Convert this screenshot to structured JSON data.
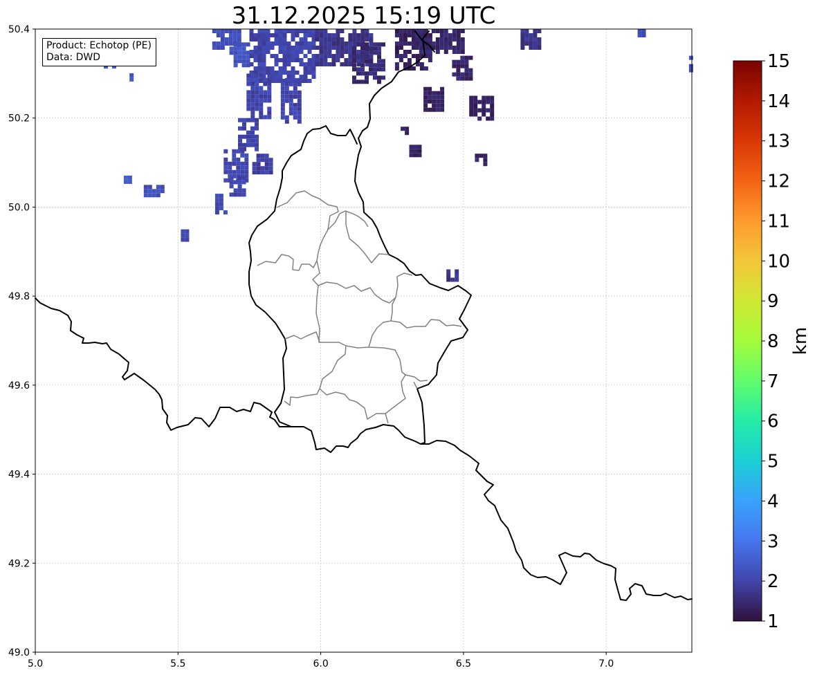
{
  "title": "31.12.2025 15:19 UTC",
  "info_box": {
    "line1": "Product: Echotop (PE)",
    "line2": "Data: DWD"
  },
  "chart_data": {
    "type": "heatmap",
    "title": "31.12.2025 15:19 UTC",
    "x_ticks": [
      "5.0",
      "5.5",
      "6.0",
      "6.5",
      "7.0"
    ],
    "y_ticks": [
      "49.0",
      "49.2",
      "49.4",
      "49.6",
      "49.8",
      "50.0",
      "50.2",
      "50.4"
    ],
    "xlim": [
      5.0,
      7.3
    ],
    "ylim": [
      49.0,
      50.4
    ],
    "grid": true,
    "colorbar": {
      "label": "km",
      "min": 1,
      "max": 15,
      "ticks": [
        "1",
        "2",
        "3",
        "4",
        "5",
        "6",
        "7",
        "8",
        "9",
        "10",
        "11",
        "12",
        "13",
        "14",
        "15"
      ],
      "colors": [
        "#30123b",
        "#4145ab",
        "#4675ed",
        "#39a2fc",
        "#1bcfd4",
        "#24eca6",
        "#61fc6c",
        "#a4fc3b",
        "#d1e834",
        "#f3c63a",
        "#fe9b2d",
        "#f36315",
        "#d93806",
        "#b11901",
        "#7a0402"
      ]
    },
    "echo_cells": [
      {
        "lon": 5.62,
        "lat": 50.36,
        "lon2": 5.72,
        "lat2": 50.4,
        "echotop_km": 2.2
      },
      {
        "lon": 5.68,
        "lat": 50.32,
        "lon2": 5.75,
        "lat2": 50.37,
        "echotop_km": 2.3
      },
      {
        "lon": 5.75,
        "lat": 50.28,
        "lon2": 5.97,
        "lat2": 50.4,
        "echotop_km": 2.0
      },
      {
        "lon": 5.74,
        "lat": 50.2,
        "lon2": 5.82,
        "lat2": 50.3,
        "echotop_km": 2.0
      },
      {
        "lon": 5.86,
        "lat": 50.19,
        "lon2": 5.92,
        "lat2": 50.29,
        "echotop_km": 2.0
      },
      {
        "lon": 5.71,
        "lat": 50.13,
        "lon2": 5.77,
        "lat2": 50.2,
        "echotop_km": 2.0
      },
      {
        "lon": 5.66,
        "lat": 50.06,
        "lon2": 5.74,
        "lat2": 50.13,
        "echotop_km": 2.1
      },
      {
        "lon": 5.76,
        "lat": 50.08,
        "lon2": 5.83,
        "lat2": 50.12,
        "echotop_km": 1.9
      },
      {
        "lon": 5.68,
        "lat": 50.03,
        "lon2": 5.73,
        "lat2": 50.07,
        "echotop_km": 2.0
      },
      {
        "lon": 5.63,
        "lat": 49.99,
        "lon2": 5.66,
        "lat2": 50.03,
        "echotop_km": 2.1
      },
      {
        "lon": 5.38,
        "lat": 50.03,
        "lon2": 5.45,
        "lat2": 50.05,
        "echotop_km": 2.2
      },
      {
        "lon": 5.31,
        "lat": 50.06,
        "lon2": 5.33,
        "lat2": 50.08,
        "echotop_km": 2.4
      },
      {
        "lon": 5.51,
        "lat": 49.93,
        "lon2": 5.53,
        "lat2": 49.95,
        "echotop_km": 2.1
      },
      {
        "lon": 5.24,
        "lat": 50.32,
        "lon2": 5.27,
        "lat2": 50.33,
        "echotop_km": 2.4
      },
      {
        "lon": 5.33,
        "lat": 50.29,
        "lon2": 5.34,
        "lat2": 50.31,
        "echotop_km": 2.4
      },
      {
        "lon": 5.98,
        "lat": 50.32,
        "lon2": 6.18,
        "lat2": 50.4,
        "echotop_km": 1.7
      },
      {
        "lon": 6.11,
        "lat": 50.28,
        "lon2": 6.22,
        "lat2": 50.37,
        "echotop_km": 1.5
      },
      {
        "lon": 6.26,
        "lat": 50.31,
        "lon2": 6.38,
        "lat2": 50.4,
        "echotop_km": 1.3
      },
      {
        "lon": 6.33,
        "lat": 50.35,
        "lon2": 6.5,
        "lat2": 50.4,
        "echotop_km": 1.4
      },
      {
        "lon": 6.46,
        "lat": 50.29,
        "lon2": 6.52,
        "lat2": 50.34,
        "echotop_km": 1.4
      },
      {
        "lon": 6.36,
        "lat": 50.22,
        "lon2": 6.43,
        "lat2": 50.27,
        "echotop_km": 1.3
      },
      {
        "lon": 6.52,
        "lat": 50.2,
        "lon2": 6.6,
        "lat2": 50.25,
        "echotop_km": 1.3
      },
      {
        "lon": 6.28,
        "lat": 50.17,
        "lon2": 6.3,
        "lat2": 50.19,
        "echotop_km": 1.4
      },
      {
        "lon": 6.31,
        "lat": 50.12,
        "lon2": 6.34,
        "lat2": 50.14,
        "echotop_km": 1.3
      },
      {
        "lon": 6.54,
        "lat": 50.1,
        "lon2": 6.57,
        "lat2": 50.12,
        "echotop_km": 1.4
      },
      {
        "lon": 6.44,
        "lat": 49.84,
        "lon2": 6.47,
        "lat2": 49.86,
        "echotop_km": 1.7
      },
      {
        "lon": 6.7,
        "lat": 50.36,
        "lon2": 6.76,
        "lat2": 50.4,
        "echotop_km": 1.7
      },
      {
        "lon": 7.11,
        "lat": 50.39,
        "lon2": 7.13,
        "lat2": 50.4,
        "echotop_km": 2.1
      },
      {
        "lon": 7.29,
        "lat": 50.31,
        "lon2": 7.3,
        "lat2": 50.34,
        "echotop_km": 2.2
      }
    ]
  }
}
